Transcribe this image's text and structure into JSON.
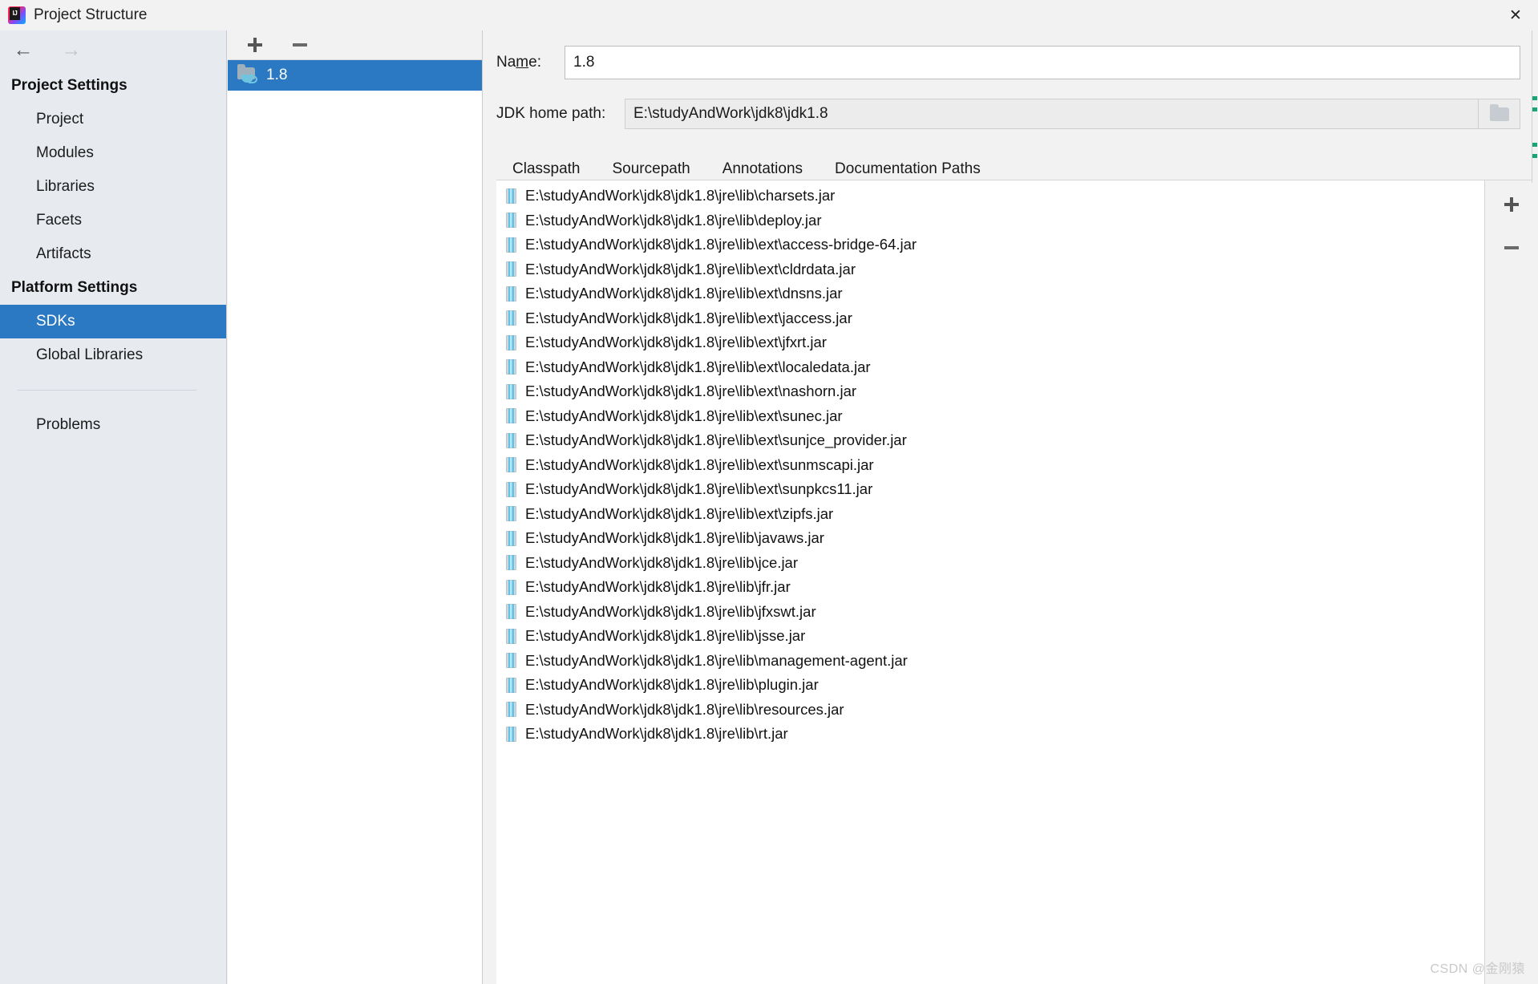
{
  "window": {
    "title": "Project Structure",
    "app_icon": "intellij-idea-icon",
    "close_label": "✕"
  },
  "sidebar": {
    "back_label": "←",
    "forward_label": "→",
    "groups": [
      {
        "header": "Project Settings",
        "items": [
          {
            "label": "Project",
            "selected": false
          },
          {
            "label": "Modules",
            "selected": false
          },
          {
            "label": "Libraries",
            "selected": false
          },
          {
            "label": "Facets",
            "selected": false
          },
          {
            "label": "Artifacts",
            "selected": false
          }
        ]
      },
      {
        "header": "Platform Settings",
        "items": [
          {
            "label": "SDKs",
            "selected": true
          },
          {
            "label": "Global Libraries",
            "selected": false
          }
        ]
      }
    ],
    "problems": {
      "label": "Problems"
    }
  },
  "sdk_panel": {
    "toolbar": {
      "add_label": "+",
      "remove_label": "−"
    },
    "items": [
      {
        "label": "1.8",
        "icon": "jdk-folder-icon",
        "selected": true
      }
    ]
  },
  "detail": {
    "name_field": {
      "label_before": "Na",
      "label_mnemonic": "m",
      "label_after": "e:",
      "value": "1.8"
    },
    "jdk_home_field": {
      "label": "JDK home path:",
      "value": "E:\\studyAndWork\\jdk8\\jdk1.8",
      "browse_icon": "folder-open-icon"
    },
    "tabs": [
      {
        "label": "Classpath",
        "active": true
      },
      {
        "label": "Sourcepath",
        "active": false
      },
      {
        "label": "Annotations",
        "active": false
      },
      {
        "label": "Documentation Paths",
        "active": false
      }
    ],
    "classpath_toolbar": {
      "add_label": "+",
      "remove_label": "−"
    },
    "classpath_entries": [
      "E:\\studyAndWork\\jdk8\\jdk1.8\\jre\\lib\\charsets.jar",
      "E:\\studyAndWork\\jdk8\\jdk1.8\\jre\\lib\\deploy.jar",
      "E:\\studyAndWork\\jdk8\\jdk1.8\\jre\\lib\\ext\\access-bridge-64.jar",
      "E:\\studyAndWork\\jdk8\\jdk1.8\\jre\\lib\\ext\\cldrdata.jar",
      "E:\\studyAndWork\\jdk8\\jdk1.8\\jre\\lib\\ext\\dnsns.jar",
      "E:\\studyAndWork\\jdk8\\jdk1.8\\jre\\lib\\ext\\jaccess.jar",
      "E:\\studyAndWork\\jdk8\\jdk1.8\\jre\\lib\\ext\\jfxrt.jar",
      "E:\\studyAndWork\\jdk8\\jdk1.8\\jre\\lib\\ext\\localedata.jar",
      "E:\\studyAndWork\\jdk8\\jdk1.8\\jre\\lib\\ext\\nashorn.jar",
      "E:\\studyAndWork\\jdk8\\jdk1.8\\jre\\lib\\ext\\sunec.jar",
      "E:\\studyAndWork\\jdk8\\jdk1.8\\jre\\lib\\ext\\sunjce_provider.jar",
      "E:\\studyAndWork\\jdk8\\jdk1.8\\jre\\lib\\ext\\sunmscapi.jar",
      "E:\\studyAndWork\\jdk8\\jdk1.8\\jre\\lib\\ext\\sunpkcs11.jar",
      "E:\\studyAndWork\\jdk8\\jdk1.8\\jre\\lib\\ext\\zipfs.jar",
      "E:\\studyAndWork\\jdk8\\jdk1.8\\jre\\lib\\javaws.jar",
      "E:\\studyAndWork\\jdk8\\jdk1.8\\jre\\lib\\jce.jar",
      "E:\\studyAndWork\\jdk8\\jdk1.8\\jre\\lib\\jfr.jar",
      "E:\\studyAndWork\\jdk8\\jdk1.8\\jre\\lib\\jfxswt.jar",
      "E:\\studyAndWork\\jdk8\\jdk1.8\\jre\\lib\\jsse.jar",
      "E:\\studyAndWork\\jdk8\\jdk1.8\\jre\\lib\\management-agent.jar",
      "E:\\studyAndWork\\jdk8\\jdk1.8\\jre\\lib\\plugin.jar",
      "E:\\studyAndWork\\jdk8\\jdk1.8\\jre\\lib\\resources.jar",
      "E:\\studyAndWork\\jdk8\\jdk1.8\\jre\\lib\\rt.jar"
    ]
  },
  "watermark": {
    "text": "CSDN @金刚猿"
  },
  "colors": {
    "selection_blue": "#2b79c2",
    "sidebar_bg": "#e7ebf0",
    "panel_bg": "#f2f2f2",
    "tab_underline": "#4e86c7",
    "jar_icon_accent": "#5fc3e8",
    "marker_green": "#17a673"
  }
}
